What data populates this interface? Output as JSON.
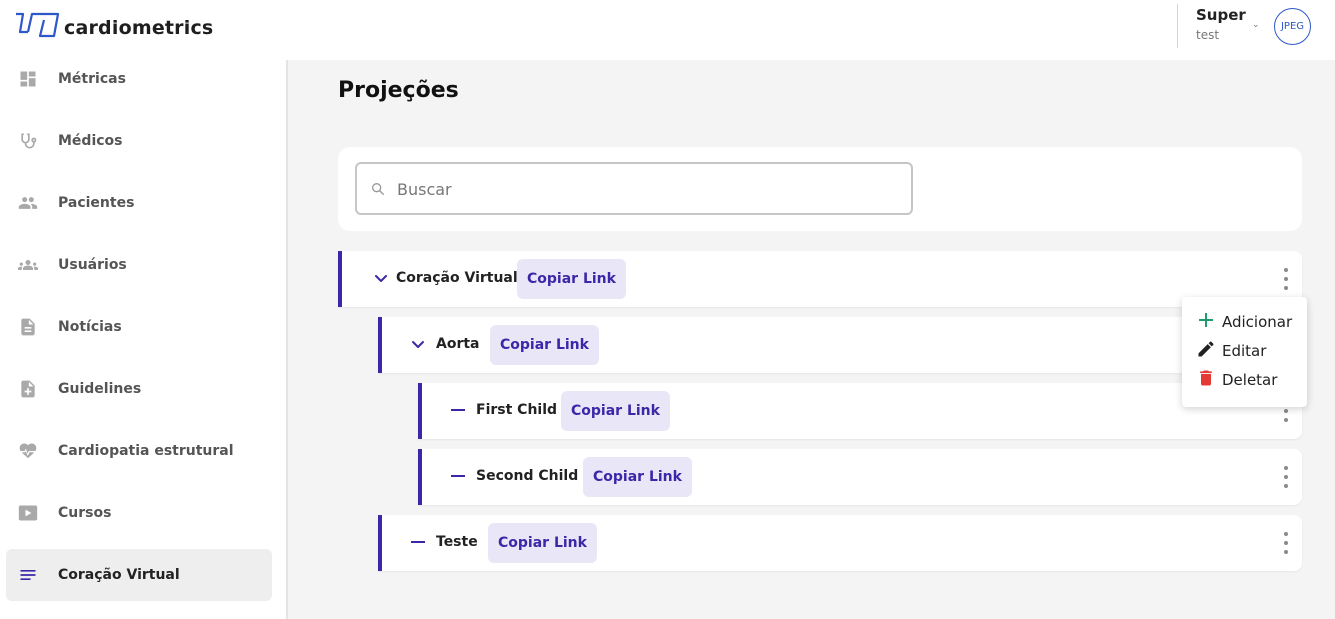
{
  "app": {
    "name": "cardiometrics"
  },
  "user": {
    "name": "Super",
    "role": "test",
    "avatar_text": "JPEG"
  },
  "sidebar": {
    "items": [
      {
        "label": "Métricas",
        "icon": "dashboard-icon"
      },
      {
        "label": "Médicos",
        "icon": "stethoscope-icon"
      },
      {
        "label": "Pacientes",
        "icon": "people-icon"
      },
      {
        "label": "Usuários",
        "icon": "groups-icon"
      },
      {
        "label": "Notícias",
        "icon": "document-icon"
      },
      {
        "label": "Guidelines",
        "icon": "note-add-icon"
      },
      {
        "label": "Cardiopatia estrutural",
        "icon": "heart-pulse-icon"
      },
      {
        "label": "Cursos",
        "icon": "play-icon"
      },
      {
        "label": "Coração Virtual",
        "icon": "list-icon",
        "active": true
      }
    ]
  },
  "page": {
    "title": "Projeções"
  },
  "search": {
    "placeholder": "Buscar",
    "value": ""
  },
  "tree": {
    "copy_label": "Copiar Link",
    "rows": [
      {
        "label": "Coração Virtual",
        "level": 0,
        "toggle": "expanded"
      },
      {
        "label": "Aorta",
        "level": 1,
        "toggle": "expanded"
      },
      {
        "label": "First Child",
        "level": 2,
        "toggle": "leaf"
      },
      {
        "label": "Second Child",
        "level": 2,
        "toggle": "leaf"
      },
      {
        "label": "Teste",
        "level": 1,
        "toggle": "leaf"
      }
    ]
  },
  "menu": {
    "items": [
      {
        "label": "Adicionar",
        "icon": "plus-icon",
        "color": "#1a9c6b"
      },
      {
        "label": "Editar",
        "icon": "pencil-icon",
        "color": "#222222"
      },
      {
        "label": "Deletar",
        "icon": "trash-icon",
        "color": "#e53935"
      }
    ]
  },
  "colors": {
    "accent": "#3b28a8",
    "copy_bg": "#e9e6f7",
    "avatar": "#2e58c9"
  }
}
